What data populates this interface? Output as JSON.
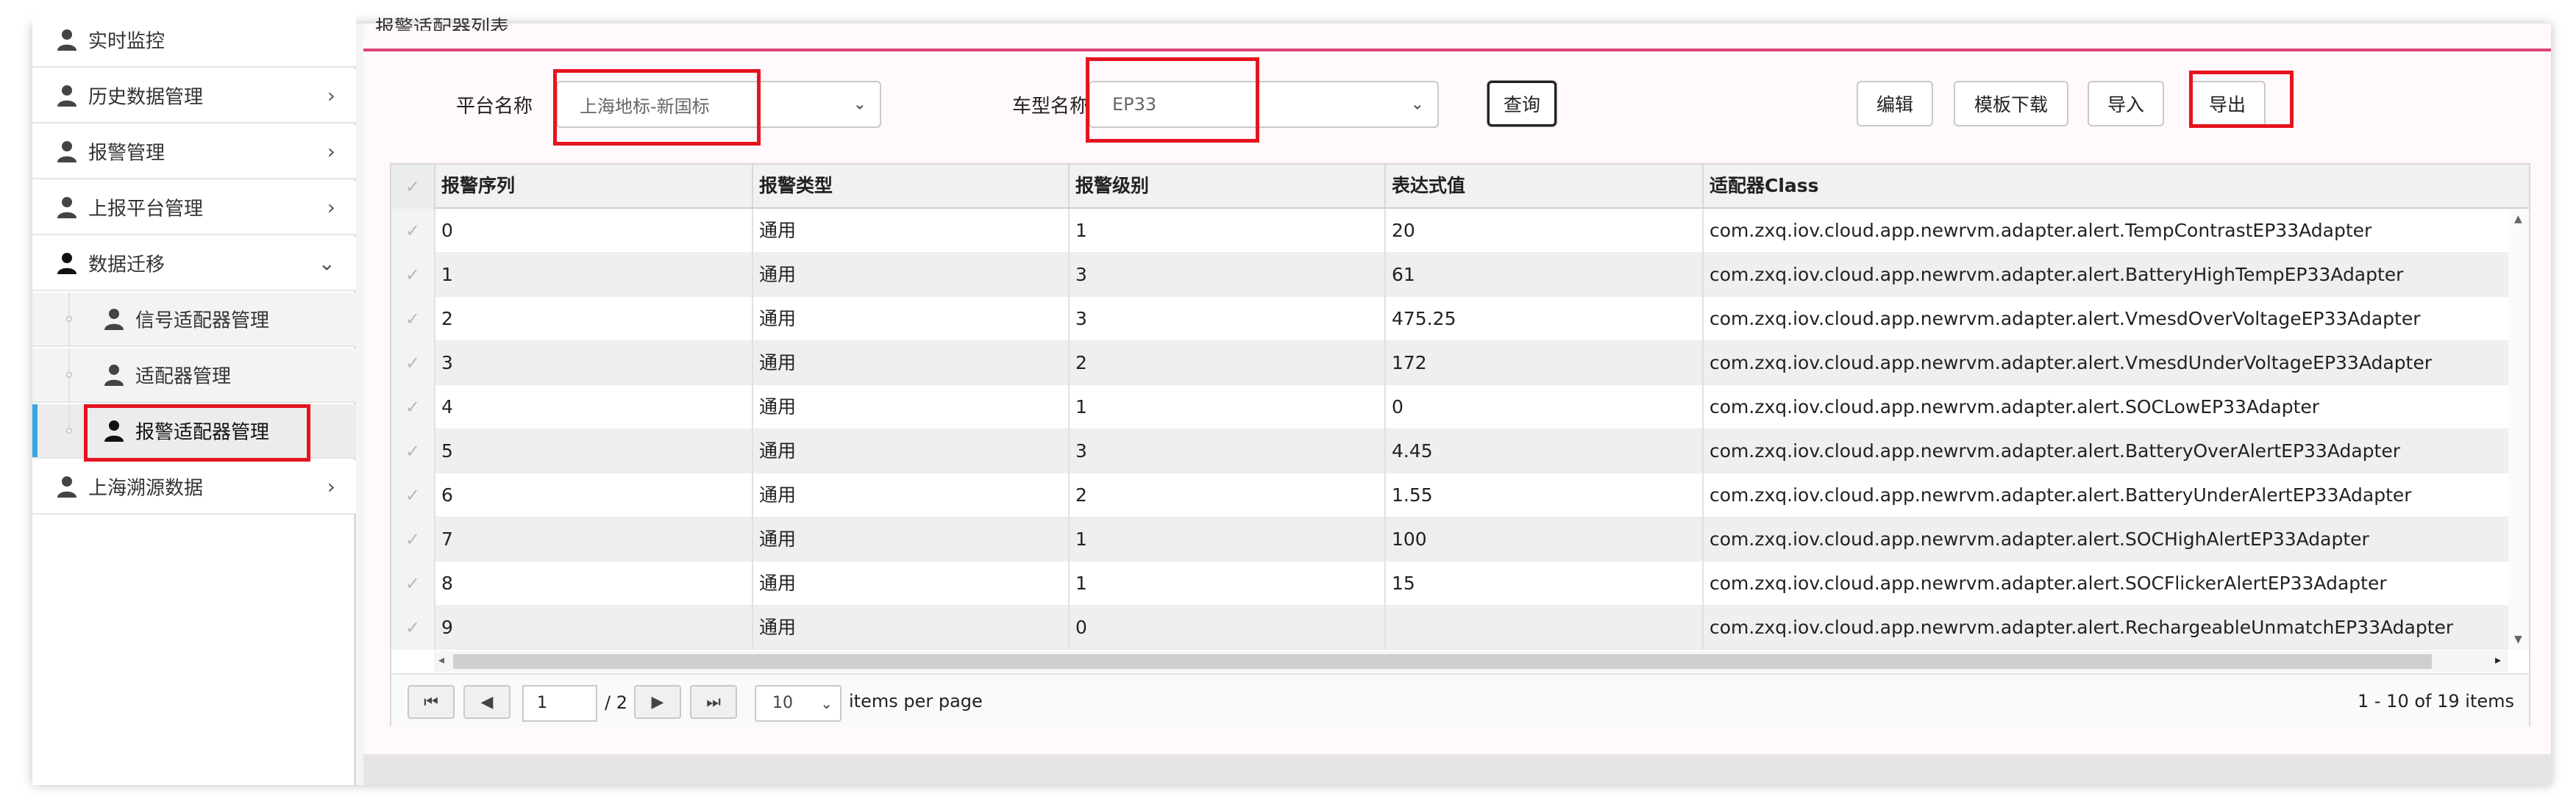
{
  "sidebar": {
    "items": [
      {
        "label": "实时监控"
      },
      {
        "label": "历史数据管理",
        "chevron": "›"
      },
      {
        "label": "报警管理",
        "chevron": "›"
      },
      {
        "label": "上报平台管理",
        "chevron": "›"
      },
      {
        "label": "数据迁移",
        "chevron": "⌄"
      }
    ],
    "subitems": [
      {
        "label": "信号适配器管理"
      },
      {
        "label": "适配器管理"
      },
      {
        "label": "报警适配器管理"
      }
    ],
    "last_item": {
      "label": "上海溯源数据",
      "chevron": "›"
    }
  },
  "header": {
    "title": "报警适配器列表"
  },
  "filters": {
    "platform_label": "平台名称",
    "platform_value": "上海地标-新国标",
    "model_label": "车型名称",
    "model_value": "EP33"
  },
  "toolbar": {
    "query": "查询",
    "edit": "编辑",
    "template_download": "模板下载",
    "import": "导入",
    "export": "导出"
  },
  "table": {
    "columns": [
      "报警序列",
      "报警类型",
      "报警级别",
      "表达式值",
      "适配器Class"
    ],
    "rows": [
      [
        "0",
        "通用",
        "1",
        "20",
        "com.zxq.iov.cloud.app.newrvm.adapter.alert.TempContrastEP33Adapter"
      ],
      [
        "1",
        "通用",
        "3",
        "61",
        "com.zxq.iov.cloud.app.newrvm.adapter.alert.BatteryHighTempEP33Adapter"
      ],
      [
        "2",
        "通用",
        "3",
        "475.25",
        "com.zxq.iov.cloud.app.newrvm.adapter.alert.VmesdOverVoltageEP33Adapter"
      ],
      [
        "3",
        "通用",
        "2",
        "172",
        "com.zxq.iov.cloud.app.newrvm.adapter.alert.VmesdUnderVoltageEP33Adapter"
      ],
      [
        "4",
        "通用",
        "1",
        "0",
        "com.zxq.iov.cloud.app.newrvm.adapter.alert.SOCLowEP33Adapter"
      ],
      [
        "5",
        "通用",
        "3",
        "4.45",
        "com.zxq.iov.cloud.app.newrvm.adapter.alert.BatteryOverAlertEP33Adapter"
      ],
      [
        "6",
        "通用",
        "2",
        "1.55",
        "com.zxq.iov.cloud.app.newrvm.adapter.alert.BatteryUnderAlertEP33Adapter"
      ],
      [
        "7",
        "通用",
        "1",
        "100",
        "com.zxq.iov.cloud.app.newrvm.adapter.alert.SOCHighAlertEP33Adapter"
      ],
      [
        "8",
        "通用",
        "1",
        "15",
        "com.zxq.iov.cloud.app.newrvm.adapter.alert.SOCFlickerAlertEP33Adapter"
      ],
      [
        "9",
        "通用",
        "0",
        "",
        "com.zxq.iov.cloud.app.newrvm.adapter.alert.RechargeableUnmatchEP33Adapter"
      ]
    ]
  },
  "pager": {
    "first": "⏮",
    "prev": "◀",
    "next": "▶",
    "last": "⏭",
    "page_value": "1",
    "of_pages": "/ 2",
    "page_size": "10",
    "per_page_label": "items per page",
    "summary": "1 - 10 of 19 items"
  },
  "icons": {
    "user": "user-icon",
    "check": "✓"
  },
  "colors": {
    "accent_pink": "#e0457b",
    "highlight_red": "#e5141e",
    "active_bar": "#3aa6e0"
  }
}
